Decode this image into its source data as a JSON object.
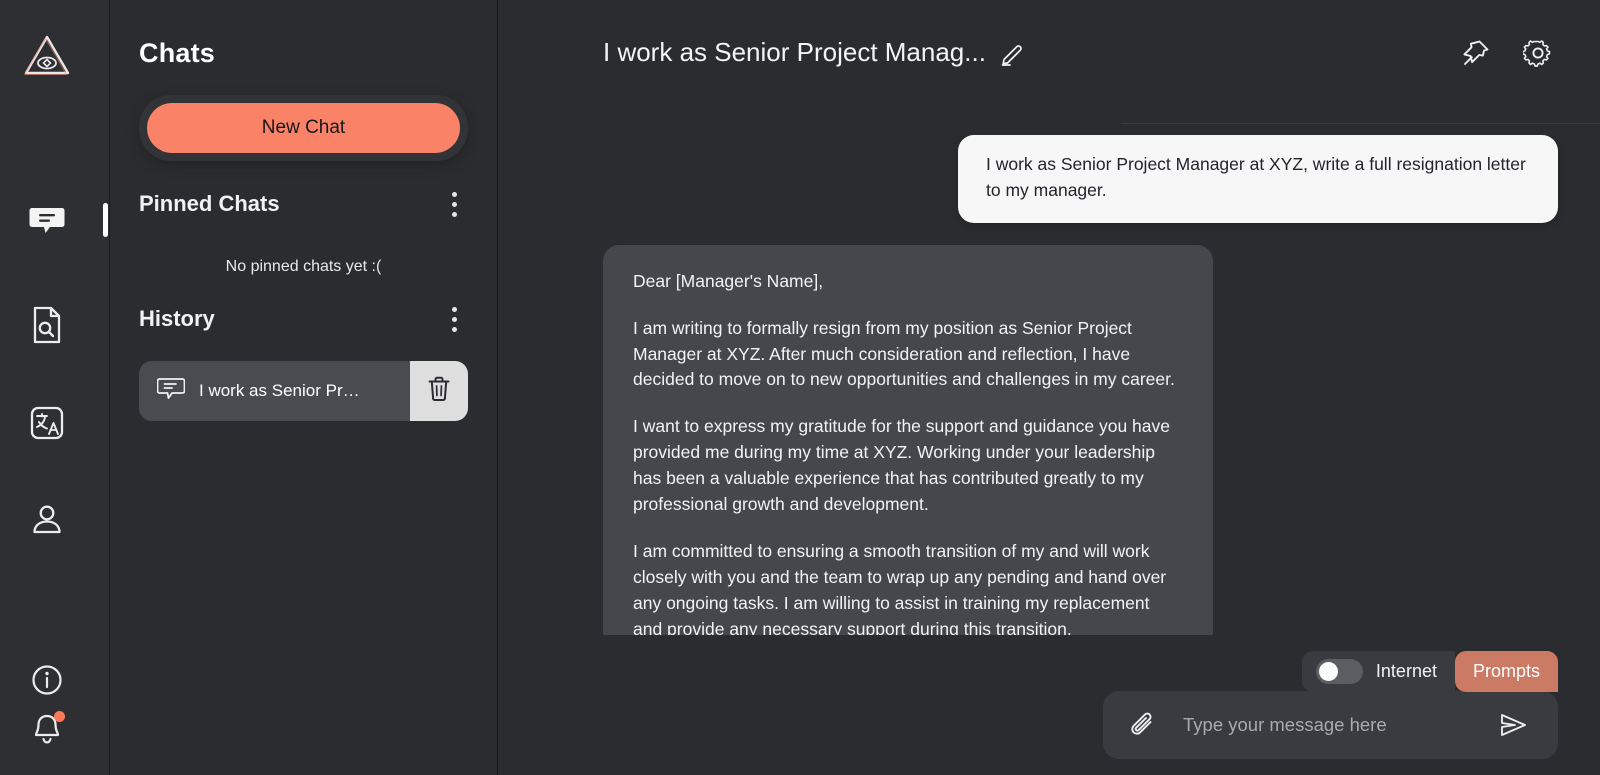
{
  "rail": {
    "logo_icon": "triangle-eye-logo-icon",
    "items": [
      {
        "name": "chat",
        "icon": "chat-bubble-icon",
        "active": true
      },
      {
        "name": "document-search",
        "icon": "document-search-icon",
        "active": false
      },
      {
        "name": "translate",
        "icon": "translate-icon",
        "active": false
      },
      {
        "name": "account",
        "icon": "user-icon",
        "active": false
      },
      {
        "name": "info",
        "icon": "info-circle-icon",
        "active": false
      },
      {
        "name": "notifications",
        "icon": "bell-icon",
        "active": false,
        "badge": true
      }
    ]
  },
  "panel": {
    "title": "Chats",
    "new_chat_label": "New Chat",
    "pinned": {
      "heading": "Pinned Chats",
      "menu_icon": "kebab-menu-icon",
      "empty_text": "No pinned chats yet :("
    },
    "history": {
      "heading": "History",
      "menu_icon": "kebab-menu-icon",
      "items": [
        {
          "label": "I work as Senior Pr…",
          "icon": "chat-bubble-outline-icon",
          "delete_icon": "trash-icon"
        }
      ]
    }
  },
  "header": {
    "title": "I work as Senior Project Manag...",
    "edit_icon": "pencil-edit-icon",
    "pin_icon": "pushpin-icon",
    "settings_icon": "gear-icon"
  },
  "conversation": {
    "user_message": "I work as Senior Project Manager at XYZ, write a full resignation letter to my manager.",
    "assistant_paragraphs": [
      "Dear [Manager's Name],",
      "I am writing to formally resign from my position as Senior Project Manager at XYZ. After much consideration and reflection, I have decided to move on to new opportunities and challenges in my career.",
      "I want to express my gratitude for the support and guidance you have provided me during my time at XYZ. Working under your leadership has been a valuable experience that has contributed greatly to my professional growth and development.",
      "I am committed to ensuring a smooth transition of my and will work closely with you and the team to wrap up any pending and hand over any ongoing tasks. I am willing to assist in training my replacement and provide any necessary support during this transition."
    ]
  },
  "toolbar": {
    "internet_label": "Internet",
    "internet_enabled": false,
    "prompts_label": "Prompts"
  },
  "composer": {
    "placeholder": "Type your message here",
    "value": "",
    "attach_icon": "paperclip-icon",
    "send_icon": "send-paper-plane-icon"
  },
  "colors": {
    "accent": "#fa8266",
    "prompts_chip": "#cb7a64",
    "notification_dot": "#fa7a5a",
    "background": "#2b2c30",
    "bot_bubble": "#46474c",
    "user_bubble": "#f7f7f8"
  }
}
